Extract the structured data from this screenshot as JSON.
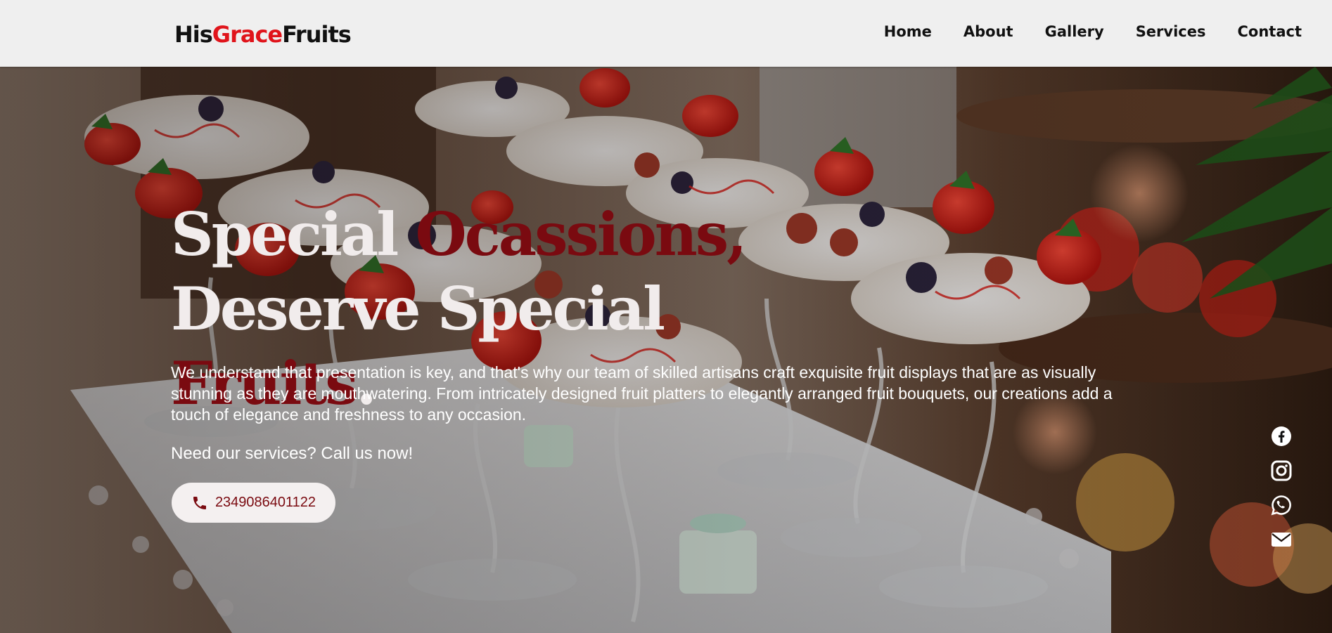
{
  "header": {
    "logo": {
      "part1": "His",
      "part2": "Grace",
      "part3": "Fruits"
    },
    "nav": [
      "Home",
      "About",
      "Gallery",
      "Services",
      "Contact"
    ]
  },
  "hero": {
    "headline": {
      "line1_light": "Special ",
      "line1_dark": "Ocassions,",
      "line2_light": "Deserve Special ",
      "line2_dark": "Fruits",
      "line2_end": "."
    },
    "intro": "We understand that presentation is key, and that's why our team of skilled artisans craft exquisite fruit displays that are as visually stunning as they are mouthwatering. From intricately designed fruit platters to elegantly arranged fruit bouquets, our creations add a touch of elegance and freshness to any occasion.",
    "cta_text": "Need our services? Call us now!",
    "phone": "2349086401122"
  },
  "social": [
    "facebook-icon",
    "instagram-icon",
    "whatsapp-icon",
    "email-icon"
  ],
  "colors": {
    "accent_red": "#e0141b",
    "dark_red": "#7a0a10",
    "header_bg": "#efefef"
  }
}
